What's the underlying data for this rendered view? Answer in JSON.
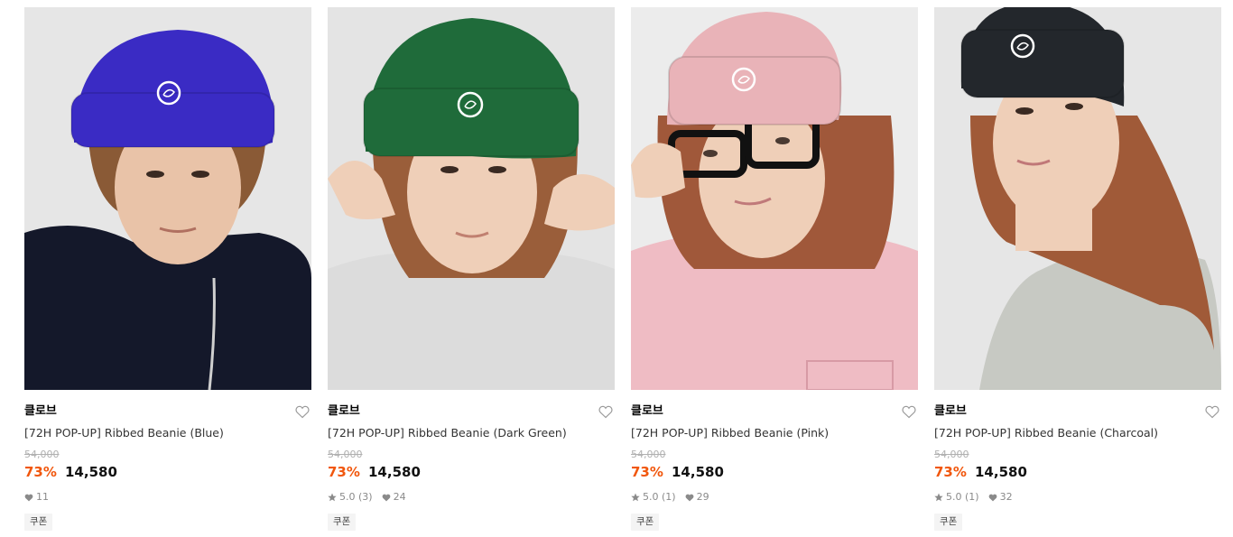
{
  "products": [
    {
      "brand": "클로브",
      "title": "[72H POP-UP] Ribbed Beanie (Blue)",
      "original_price": "54,000",
      "discount": "73%",
      "price": "14,580",
      "rating": "",
      "likes": "11",
      "coupon": "쿠폰",
      "beanie_color": "#3a2bc4",
      "shirt_color": "#14182a",
      "bg_color": "#e6e6e6",
      "hair_color": "#8a5a36"
    },
    {
      "brand": "클로브",
      "title": "[72H POP-UP] Ribbed Beanie (Dark Green)",
      "original_price": "54,000",
      "discount": "73%",
      "price": "14,580",
      "rating": "5.0 (3)",
      "likes": "24",
      "coupon": "쿠폰",
      "beanie_color": "#1f6b3a",
      "shirt_color": "#dcdcdc",
      "bg_color": "#e4e4e4",
      "hair_color": "#9a5e3a"
    },
    {
      "brand": "클로브",
      "title": "[72H POP-UP] Ribbed Beanie (Pink)",
      "original_price": "54,000",
      "discount": "73%",
      "price": "14,580",
      "rating": "5.0 (1)",
      "likes": "29",
      "coupon": "쿠폰",
      "beanie_color": "#e9b3b8",
      "shirt_color": "#efbcc4",
      "bg_color": "#ececec",
      "hair_color": "#a0583a"
    },
    {
      "brand": "클로브",
      "title": "[72H POP-UP] Ribbed Beanie (Charcoal)",
      "original_price": "54,000",
      "discount": "73%",
      "price": "14,580",
      "rating": "5.0 (1)",
      "likes": "32",
      "coupon": "쿠폰",
      "beanie_color": "#23272c",
      "shirt_color": "#c7c9c3",
      "bg_color": "#e6e6e6",
      "hair_color": "#a05a38"
    }
  ],
  "colors": {
    "discount": "#f1570d",
    "strike": "#b0b0b0",
    "meta": "#8a8a8a"
  },
  "icons": {
    "like": "heart-outline-icon",
    "star": "star-icon",
    "heart_small": "heart-filled-icon"
  }
}
